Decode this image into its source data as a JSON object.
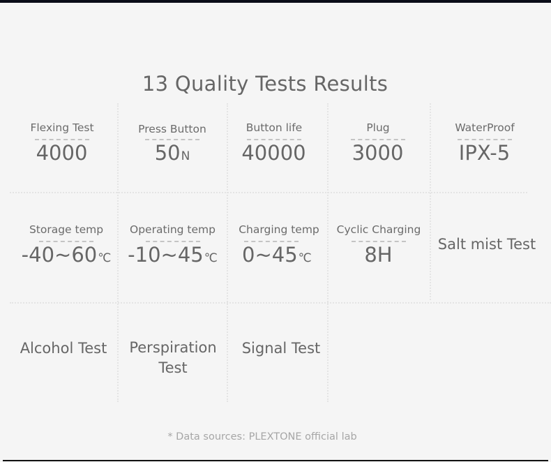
{
  "title": "13 Quality Tests Results",
  "colors": {
    "background": "#f5f5f5",
    "text": "#666666",
    "footer_text": "#a6a6a6",
    "grid_line": "#e4e4e4"
  },
  "tests": [
    {
      "label": "Flexing Test",
      "value": "4000",
      "unit": ""
    },
    {
      "label": "Press Button",
      "value": "50",
      "unit": "N"
    },
    {
      "label": "Button life",
      "value": "40000",
      "unit": ""
    },
    {
      "label": "Plug",
      "value": "3000",
      "unit": ""
    },
    {
      "label": "WaterProof",
      "value": "IPX-5",
      "unit": ""
    },
    {
      "label": "Storage temp",
      "value": "-40~60",
      "unit": "℃"
    },
    {
      "label": "Operating temp",
      "value": "-10~45",
      "unit": "℃"
    },
    {
      "label": "Charging temp",
      "value": "0~45",
      "unit": "℃"
    },
    {
      "label": "Cyclic Charging",
      "value": "8H",
      "unit": ""
    },
    {
      "label": "Salt mist Test"
    },
    {
      "label": "Alcohol Test"
    },
    {
      "label": "Perspiration Test"
    },
    {
      "label": "Signal Test"
    }
  ],
  "footer": "* Data sources: PLEXTONE official lab"
}
